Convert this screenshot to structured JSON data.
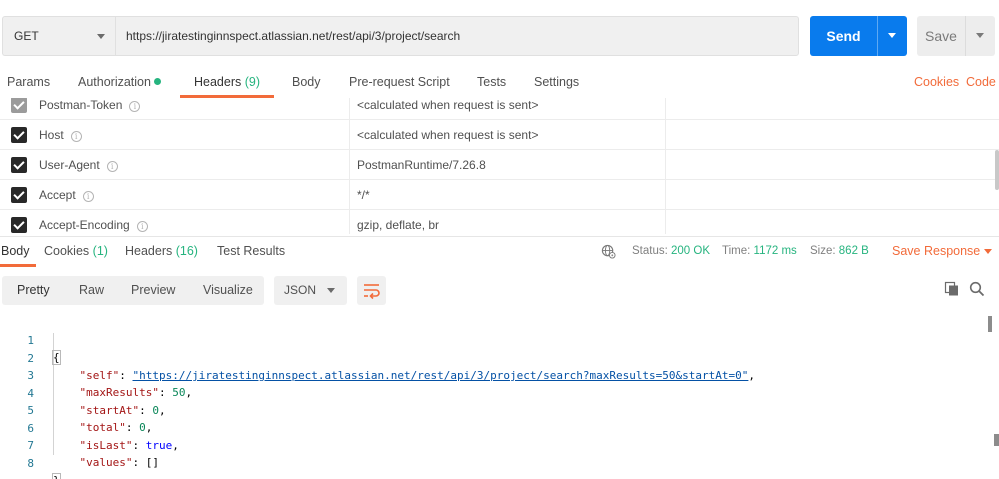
{
  "request": {
    "method": "GET",
    "url": "https://jiratestinginnspect.atlassian.net/rest/api/3/project/search",
    "send_label": "Send",
    "save_label": "Save"
  },
  "request_tabs": [
    {
      "label": "Params"
    },
    {
      "label": "Authorization"
    },
    {
      "label": "Headers",
      "count": "(9)"
    },
    {
      "label": "Body"
    },
    {
      "label": "Pre-request Script"
    },
    {
      "label": "Tests"
    },
    {
      "label": "Settings"
    }
  ],
  "request_links": {
    "cookies": "Cookies",
    "code": "Code"
  },
  "headers": [
    {
      "key": "Postman-Token",
      "value": "<calculated when request is sent>",
      "checked": true
    },
    {
      "key": "Host",
      "value": "<calculated when request is sent>",
      "checked": true
    },
    {
      "key": "User-Agent",
      "value": "PostmanRuntime/7.26.8",
      "checked": true
    },
    {
      "key": "Accept",
      "value": "*/*",
      "checked": true
    },
    {
      "key": "Accept-Encoding",
      "value": "gzip, deflate, br",
      "checked": true
    }
  ],
  "response_tabs": [
    {
      "label": "Body"
    },
    {
      "label": "Cookies",
      "count": "(1)"
    },
    {
      "label": "Headers",
      "count": "(16)"
    },
    {
      "label": "Test Results"
    }
  ],
  "response_status": {
    "status_label": "Status:",
    "status_value": "200 OK",
    "time_label": "Time:",
    "time_value": "1172 ms",
    "size_label": "Size:",
    "size_value": "862 B",
    "save_response": "Save Response"
  },
  "view_modes": [
    "Pretty",
    "Raw",
    "Preview",
    "Visualize"
  ],
  "format": "JSON",
  "code_lines": [
    {
      "n": "1"
    },
    {
      "n": "2"
    },
    {
      "n": "3"
    },
    {
      "n": "4"
    },
    {
      "n": "5"
    },
    {
      "n": "6"
    },
    {
      "n": "7"
    },
    {
      "n": "8"
    }
  ],
  "json_tokens": {
    "open": "{",
    "close": "}",
    "self_key": "\"self\"",
    "self_val": "\"https://jiratestinginnspect.atlassian.net/rest/api/3/project/search?maxResults=50&startAt=0\"",
    "max_key": "\"maxResults\"",
    "max_val": "50",
    "start_key": "\"startAt\"",
    "start_val": "0",
    "total_key": "\"total\"",
    "total_val": "0",
    "islast_key": "\"isLast\"",
    "islast_val": "true",
    "values_key": "\"values\"",
    "values_val": "[]"
  },
  "colors": {
    "accent": "#f26b3a",
    "send_blue": "#097bed",
    "success": "#26b47f"
  }
}
